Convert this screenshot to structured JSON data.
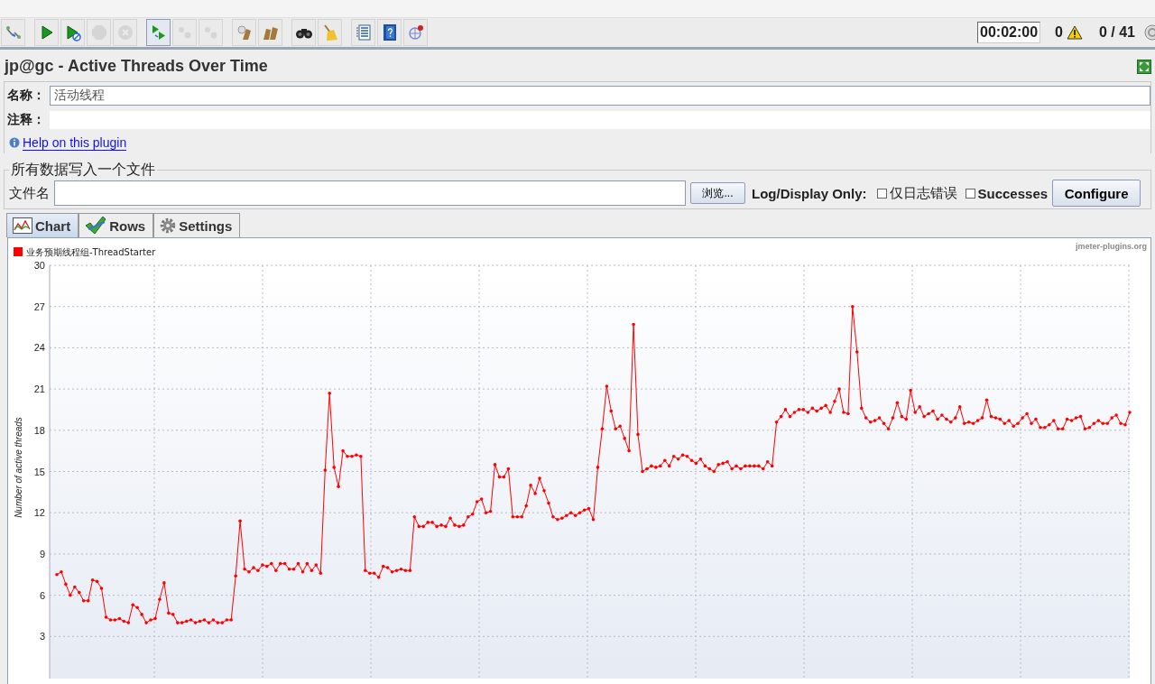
{
  "toolbar": [
    {
      "kind": "templates",
      "disabled": false
    },
    {
      "kind": "separator"
    },
    {
      "kind": "start",
      "disabled": false
    },
    {
      "kind": "start-no-timers",
      "disabled": false
    },
    {
      "kind": "stop",
      "disabled": true
    },
    {
      "kind": "shutdown",
      "disabled": true
    },
    {
      "kind": "separator"
    },
    {
      "kind": "remote-start",
      "disabled": false
    },
    {
      "kind": "remote-stop",
      "disabled": true
    },
    {
      "kind": "remote-shutdown",
      "disabled": true
    },
    {
      "kind": "separator"
    },
    {
      "kind": "clear",
      "disabled": false
    },
    {
      "kind": "clear-all",
      "disabled": false
    },
    {
      "kind": "separator"
    },
    {
      "kind": "search",
      "disabled": false
    },
    {
      "kind": "reset-search",
      "disabled": false
    },
    {
      "kind": "separator"
    },
    {
      "kind": "list",
      "disabled": false
    },
    {
      "kind": "help",
      "disabled": false
    },
    {
      "kind": "tool",
      "disabled": false
    }
  ],
  "status": {
    "timer": "00:02:00",
    "warnings": "0",
    "threads": "0 / 41"
  },
  "title": "jp@gc - Active Threads Over Time",
  "name_label": "名称：",
  "name_value": "活动线程",
  "comment_label": "注释：",
  "help_link": "Help on this plugin",
  "file_section": {
    "legend": "所有数据写入一个文件",
    "filename_label": "文件名",
    "browse_button": "浏览...",
    "log_label": "Log/Display Only:",
    "checkboxes": [
      {
        "label": "仅日志错误",
        "checked": false
      },
      {
        "label": "Successes",
        "checked": false
      }
    ],
    "configure_button": "Configure"
  },
  "tabs": [
    {
      "label": "Chart",
      "kind": "chart",
      "selected": true
    },
    {
      "label": "Rows",
      "kind": "rows",
      "selected": false
    },
    {
      "label": "Settings",
      "kind": "settings",
      "selected": false
    }
  ],
  "chart": {
    "credit": "jmeter-plugins.org",
    "chart_data": {
      "type": "line",
      "grid": true,
      "ylabel": "Number of active threads",
      "ylim": [
        0,
        30
      ],
      "yticks": [
        3,
        6,
        9,
        12,
        15,
        18,
        21,
        24,
        27,
        30
      ],
      "series": [
        {
          "name": "业务预期线程组-ThreadStarter",
          "color": "#ff0000",
          "values": [
            7.5,
            7.7,
            6.8,
            6.0,
            6.6,
            6.2,
            5.6,
            5.6,
            7.1,
            7.0,
            6.5,
            4.4,
            4.2,
            4.2,
            4.3,
            4.1,
            4.0,
            5.3,
            5.1,
            4.6,
            4.0,
            4.2,
            4.3,
            5.7,
            6.9,
            4.7,
            4.6,
            4.0,
            4.0,
            4.1,
            4.2,
            4.0,
            4.1,
            4.2,
            4.0,
            4.2,
            4.0,
            4.0,
            4.2,
            4.2,
            7.4,
            11.4,
            7.9,
            7.7,
            8.0,
            7.8,
            8.2,
            8.1,
            8.3,
            7.8,
            8.3,
            8.3,
            7.9,
            7.9,
            8.3,
            7.7,
            8.3,
            7.8,
            8.2,
            7.6,
            15.1,
            20.7,
            15.3,
            13.9,
            16.5,
            16.1,
            16.1,
            16.2,
            16.1,
            7.8,
            7.6,
            7.6,
            7.3,
            8.1,
            8.0,
            7.7,
            7.8,
            7.9,
            7.8,
            7.8,
            11.7,
            11.0,
            11.0,
            11.3,
            11.3,
            11.0,
            11.1,
            11.0,
            11.6,
            11.1,
            11.0,
            11.1,
            11.7,
            11.9,
            12.8,
            13.0,
            12.0,
            12.1,
            15.5,
            14.6,
            14.6,
            15.2,
            11.7,
            11.7,
            11.7,
            12.5,
            14.0,
            13.4,
            14.5,
            13.6,
            12.7,
            11.7,
            11.5,
            11.6,
            11.8,
            12.0,
            11.8,
            12.0,
            12.2,
            12.3,
            11.5,
            15.3,
            18.1,
            21.2,
            19.4,
            18.1,
            18.3,
            17.4,
            16.5,
            25.7,
            17.7,
            15.0,
            15.2,
            15.4,
            15.3,
            15.4,
            15.8,
            15.4,
            16.1,
            15.9,
            16.2,
            16.1,
            15.8,
            15.6,
            15.9,
            15.4,
            15.2,
            15.0,
            15.5,
            15.6,
            15.7,
            15.2,
            15.4,
            15.2,
            15.4,
            15.4,
            15.4,
            15.4,
            15.2,
            15.7,
            15.4,
            18.6,
            19.0,
            19.5,
            19.0,
            19.3,
            19.5,
            19.5,
            19.3,
            19.6,
            19.4,
            19.6,
            19.8,
            19.3,
            20.1,
            21.0,
            19.3,
            19.2,
            27.0,
            23.7,
            19.6,
            18.9,
            18.6,
            18.7,
            18.9,
            18.5,
            18.1,
            18.9,
            20.0,
            19.0,
            18.8,
            20.9,
            19.3,
            19.7,
            19.0,
            19.2,
            19.4,
            18.8,
            19.1,
            18.8,
            18.6,
            18.9,
            19.7,
            18.5,
            18.6,
            18.5,
            18.7,
            18.9,
            20.2,
            19.0,
            18.9,
            18.8,
            18.5,
            18.7,
            18.3,
            18.5,
            18.9,
            19.2,
            18.5,
            18.8,
            18.2,
            18.2,
            18.4,
            18.7,
            18.1,
            18.1,
            18.8,
            18.7,
            18.9,
            19.0,
            18.1,
            18.2,
            18.5,
            18.7,
            18.5,
            18.5,
            18.9,
            19.1,
            18.5,
            18.4,
            19.3
          ]
        }
      ]
    }
  }
}
